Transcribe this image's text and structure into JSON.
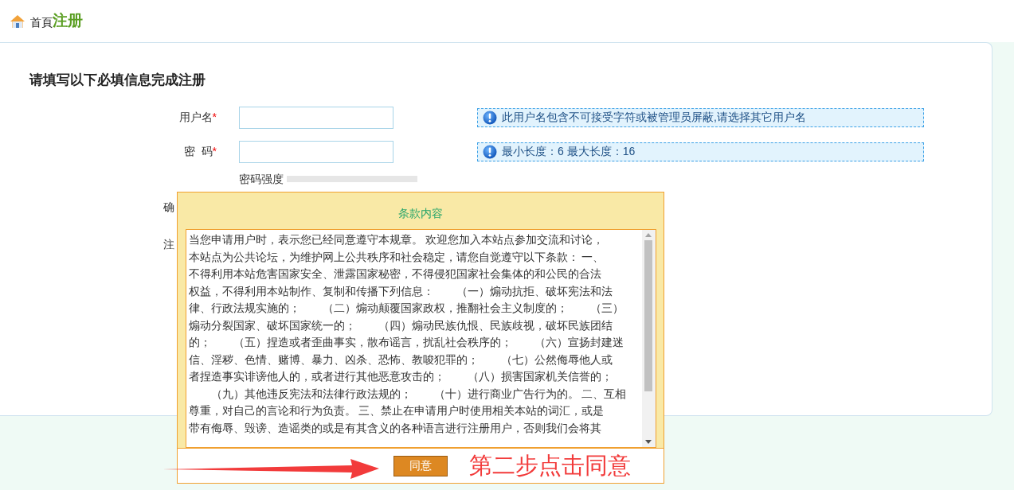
{
  "breadcrumb": {
    "home": "首頁",
    "current": "注册"
  },
  "form": {
    "title": "请填写以下必填信息完成注册",
    "fields": [
      {
        "label": "用户名",
        "required_mark": "*",
        "hint": "此用户名包含不可接受字符或被管理员屏蔽,请选择其它用户名"
      },
      {
        "label": "密  码",
        "required_mark": "*",
        "hint": "最小长度：6 最大长度：16"
      }
    ],
    "strength": {
      "label": "密码强度",
      "level": 0
    },
    "partial_labels": [
      "确",
      "注"
    ]
  },
  "dialog": {
    "title": "条款内容",
    "terms": [
      "当您申请用户时，表示您已经同意遵守本规章。 欢迎您加入本站点参加交流和讨论，",
      "本站点为公共论坛，为维护网上公共秩序和社会稳定，请您自觉遵守以下条款： 一、",
      "不得利用本站危害国家安全、泄露国家秘密，不得侵犯国家社会集体的和公民的合法",
      "权益，不得利用本站制作、复制和传播下列信息：　　（一）煽动抗拒、破坏宪法和法",
      "律、行政法规实施的；　　（二）煽动颠覆国家政权，推翻社会主义制度的；　　（三）",
      "煽动分裂国家、破坏国家统一的；　　（四）煽动民族仇恨、民族歧视，破坏民族团结",
      "的；　　（五）捏造或者歪曲事实，散布谣言，扰乱社会秩序的；　　（六）宣扬封建迷",
      "信、淫秽、色情、赌博、暴力、凶杀、恐怖、教唆犯罪的；　　（七）公然侮辱他人或",
      "者捏造事实诽谤他人的，或者进行其他恶意攻击的；　　（八）损害国家机关信誉的；",
      "　　（九）其他违反宪法和法律行政法规的；　　（十）进行商业广告行为的。 二、互相",
      "尊重，对自己的言论和行为负责。 三、禁止在申请用户时使用相关本站的词汇，或是",
      "带有侮辱、毁谤、造谣类的或是有其含义的各种语言进行注册用户，否则我们会将其"
    ],
    "agree_button": "同意"
  },
  "annotation": {
    "text": "第二步点击同意"
  }
}
